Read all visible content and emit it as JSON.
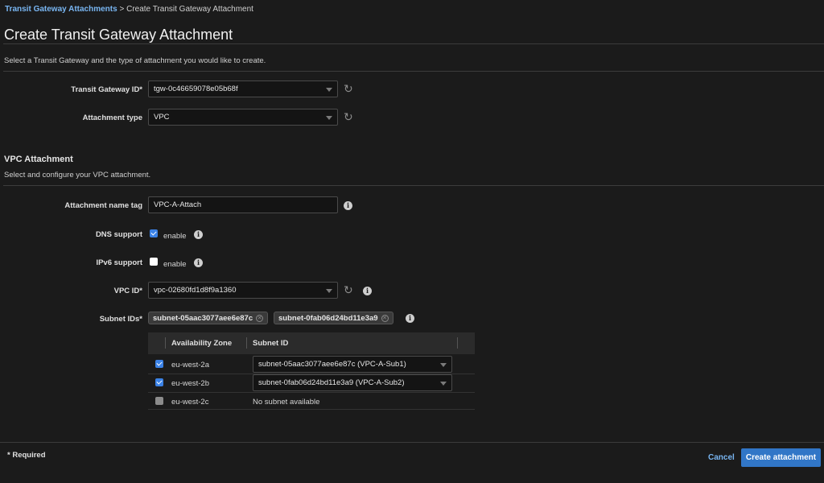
{
  "breadcrumb": {
    "link": "Transit Gateway Attachments",
    "separator": " > ",
    "current": "Create Transit Gateway Attachment"
  },
  "page_title": "Create Transit Gateway Attachment",
  "intro": "Select a Transit Gateway and the type of attachment you would like to create.",
  "form": {
    "tgw_label": "Transit Gateway ID*",
    "tgw_value": "tgw-0c46659078e05b68f",
    "type_label": "Attachment type",
    "type_value": "VPC"
  },
  "vpc_section": {
    "title": "VPC Attachment",
    "subtitle": "Select and configure your VPC attachment.",
    "name_tag_label": "Attachment name tag",
    "name_tag_value": "VPC-A-Attach",
    "dns_label": "DNS support",
    "dns_enable": "enable",
    "dns_checked": true,
    "ipv6_label": "IPv6 support",
    "ipv6_enable": "enable",
    "ipv6_checked": false,
    "vpc_label": "VPC ID*",
    "vpc_value": "vpc-02680fd1d8f9a1360",
    "subnet_label": "Subnet IDs*",
    "subnet_tokens": [
      "subnet-05aac3077aee6e87c",
      "subnet-0fab06d24bd11e3a9"
    ]
  },
  "subnet_table": {
    "headers": {
      "az": "Availability Zone",
      "subnet": "Subnet ID"
    },
    "rows": [
      {
        "az": "eu-west-2a",
        "subnet": "subnet-05aac3077aee6e87c (VPC-A-Sub1)",
        "checked": true
      },
      {
        "az": "eu-west-2b",
        "subnet": "subnet-0fab06d24bd11e3a9 (VPC-A-Sub2)",
        "checked": true
      },
      {
        "az": "eu-west-2c",
        "subnet": "No subnet available",
        "checked": false
      }
    ]
  },
  "footer": {
    "required": "* Required",
    "cancel": "Cancel",
    "create": "Create attachment"
  },
  "icons": {
    "refresh": "refresh-icon",
    "info": "info-icon",
    "caret": "chevron-down-icon"
  },
  "colors": {
    "accent": "#3176c7",
    "link": "#79b6f2",
    "background": "#1b1b1b"
  }
}
